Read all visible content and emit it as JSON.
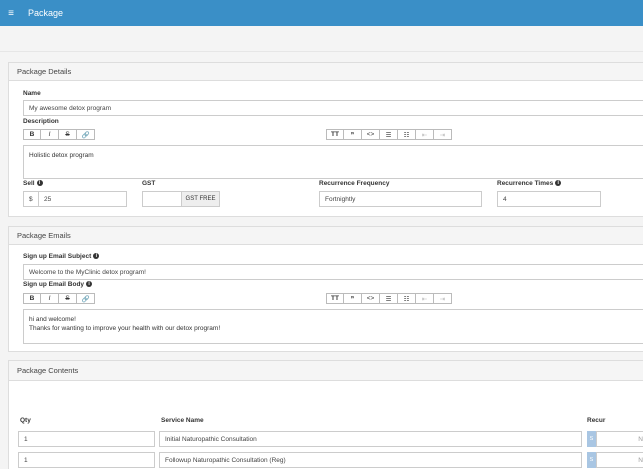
{
  "header": {
    "menu_icon": "≡",
    "title": "Package"
  },
  "details": {
    "panel_title": "Package Details",
    "name_label": "Name",
    "name_value": "My awesome detox program",
    "description_label": "Description",
    "description_value": "Holistic detox program",
    "sell_label": "Sell",
    "currency": "$",
    "sell_value": "25",
    "gst_label": "GST",
    "gst_value": "",
    "gst_addon": "GST FREE",
    "recurrence_frequency_label": "Recurrence Frequency",
    "recurrence_frequency_value": "Fortnightly",
    "recurrence_times_label": "Recurrence Times",
    "recurrence_times_value": "4"
  },
  "toolbar": {
    "bold": "B",
    "italic": "I",
    "strike": "S",
    "link": "🔗",
    "heading": "TT",
    "quote": "❞",
    "code": "<>",
    "ul": "☰",
    "ol": "☷",
    "outdent": "⇤",
    "indent": "⇥"
  },
  "emails": {
    "panel_title": "Package Emails",
    "subject_label": "Sign up Email Subject",
    "subject_value": "Welcome to the MyClinic detox program!",
    "body_label": "Sign up Email Body",
    "body_line1": "hi and welcome!",
    "body_line2": "Thanks for wanting to improve your health with our detox program!"
  },
  "contents": {
    "panel_title": "Package Contents",
    "columns": {
      "qty": "Qty",
      "service": "Service Name",
      "recur": "Recur"
    },
    "rows": [
      {
        "qty": "1",
        "service": "Initial Naturopathic Consultation",
        "recur_badge": "S",
        "recur_text": "N"
      },
      {
        "qty": "1",
        "service": "Followup Naturopathic Consultation (Reg)",
        "recur_badge": "S",
        "recur_text": "N"
      }
    ]
  },
  "colors": {
    "topbar": "#3a8fc7",
    "recur_badge": "#a9c6e3"
  }
}
